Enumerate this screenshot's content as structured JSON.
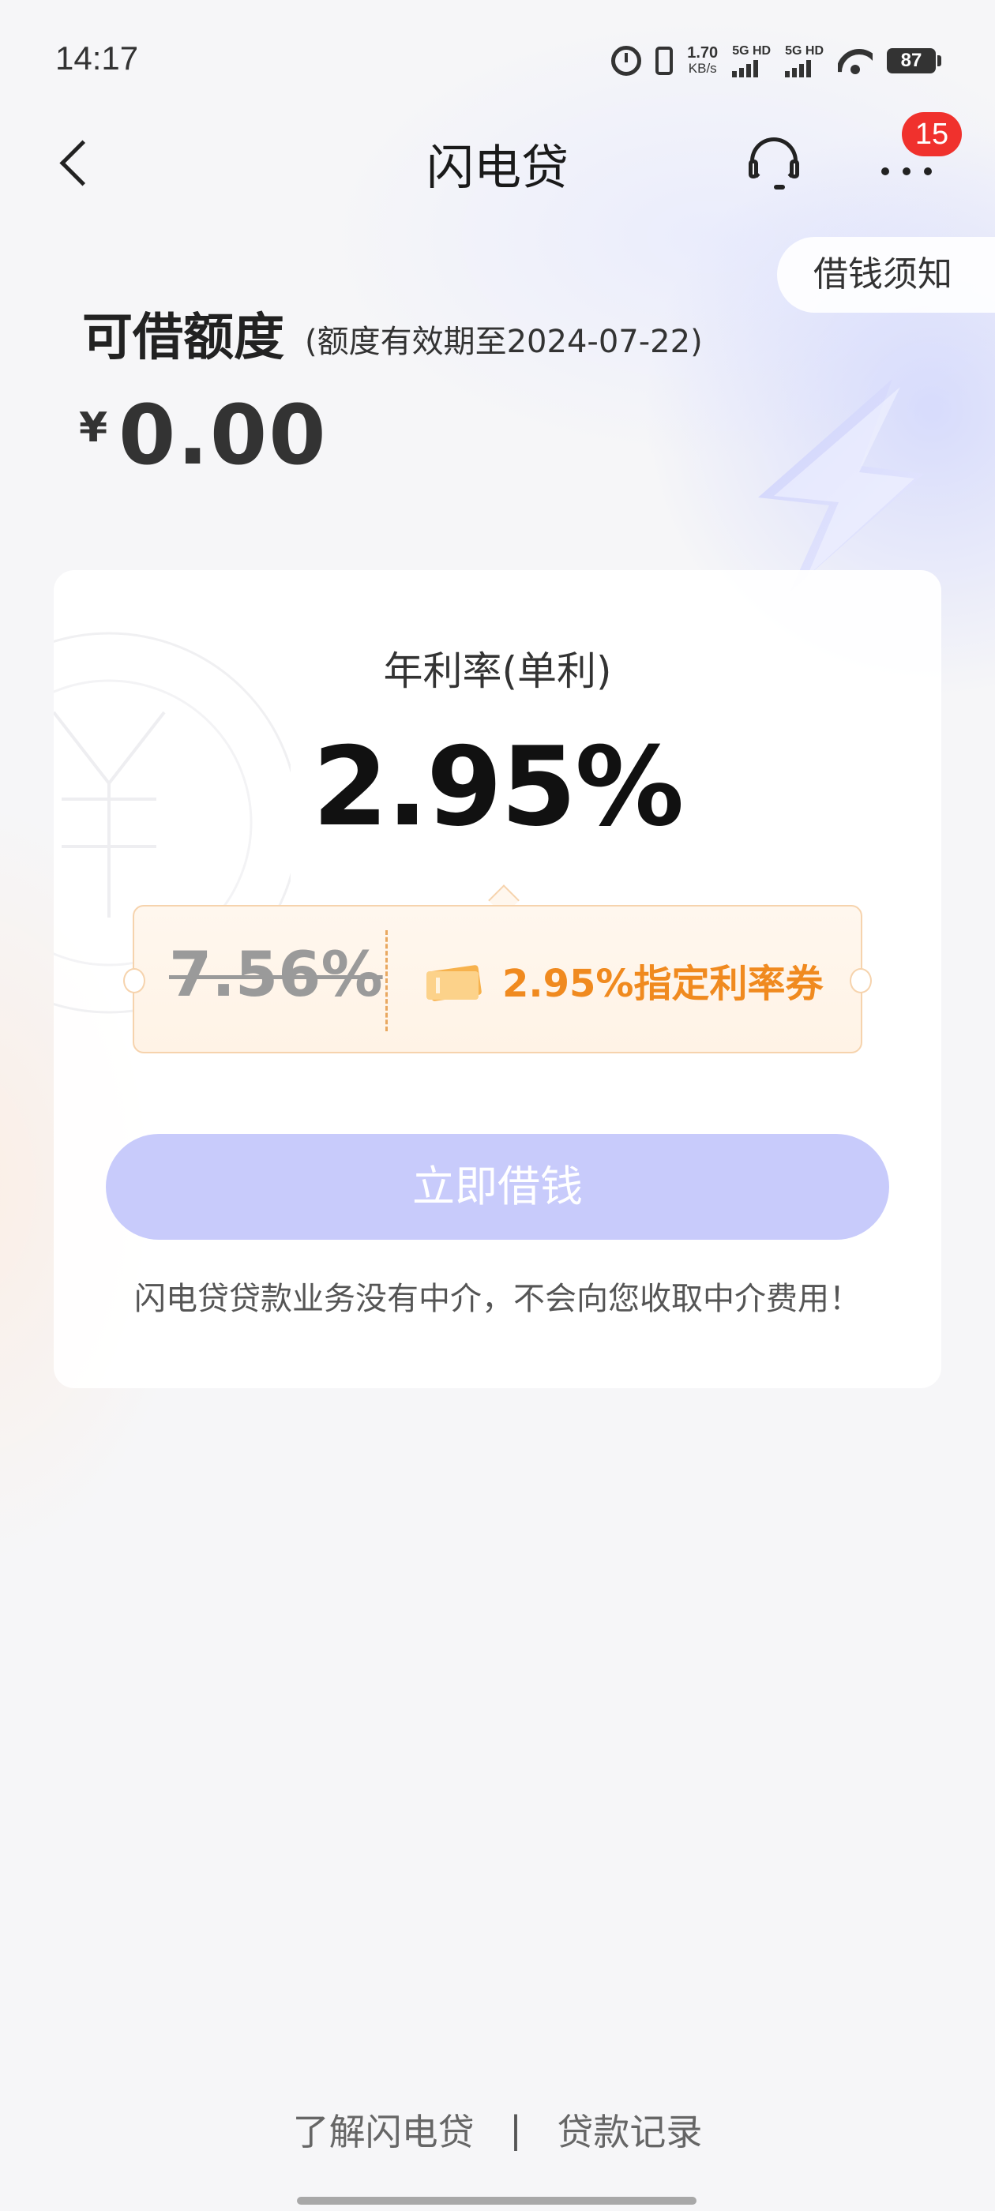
{
  "status_bar": {
    "time": "14:17",
    "net_speed": "1.70",
    "net_unit": "KB/s",
    "sim1_label": "5G HD",
    "sim2_label": "5G HD",
    "battery": "87"
  },
  "header": {
    "title": "闪电贷",
    "badge_count": "15"
  },
  "notice_button": "借钱须知",
  "credit": {
    "title": "可借额度",
    "validity": "(额度有效期至2024-07-22)",
    "currency": "¥",
    "amount": "0.00"
  },
  "rate_card": {
    "label": "年利率(单利)",
    "rate": "2.95%",
    "coupon": {
      "original_rate": "7.56%",
      "text": "2.95%指定利率券"
    },
    "borrow_button": "立即借钱",
    "disclaimer": "闪电贷贷款业务没有中介，不会向您收取中介费用！"
  },
  "footer": {
    "link_about": "了解闪电贷",
    "separator": "|",
    "link_records": "贷款记录"
  },
  "colors": {
    "accent_orange": "#f08a1f",
    "button_disabled": "#c8cbfb",
    "badge_red": "#f0312d"
  }
}
